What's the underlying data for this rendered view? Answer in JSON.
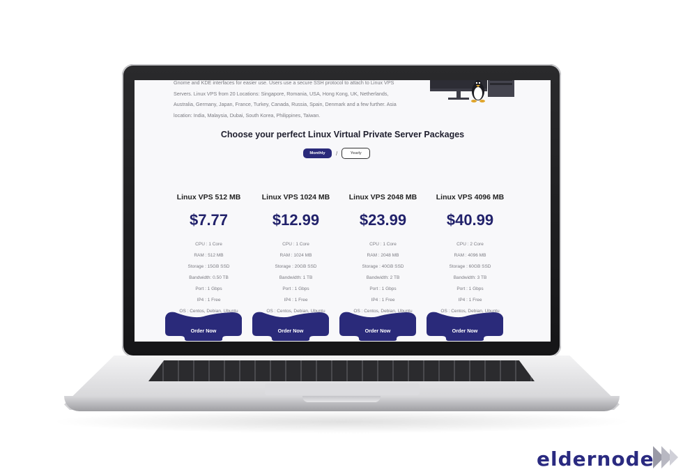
{
  "intro": {
    "lines": [
      "Gnome and KDE interfaces for easier use. Users use a secure SSH protocol to attach to Linux VPS",
      "Servers. Linux VPS from 20 Locations: Singapore, Romania, USA, Hong Kong, UK, Netherlands,",
      "Australia, Germany, Japan, France, Turkey, Canada, Russia, Spain, Denmark and a few further. Asia",
      "location: India, Malaysia, Dubai, South Korea, Philippines, Taiwan."
    ]
  },
  "heading": "Choose your perfect Linux Virtual Private Server Packages",
  "billing": {
    "monthly": "Monthly",
    "separator": "/",
    "yearly": "Yearly"
  },
  "plans": [
    {
      "name": "Linux VPS 512 MB",
      "price": "$7.77",
      "specs": [
        "CPU : 1 Core",
        "RAM : 512 MB",
        "Storage : 15GB SSD",
        "Bandwidth: 0.50 TB",
        "Port : 1 Gbps",
        "IP4 : 1 Free",
        "OS : Centos, Debian, Ubuntu"
      ],
      "order": "Order Now"
    },
    {
      "name": "Linux VPS 1024 MB",
      "price": "$12.99",
      "specs": [
        "CPU : 1 Core",
        "RAM : 1024 MB",
        "Storage : 20GB SSD",
        "Bandwidth: 1 TB",
        "Port : 1 Gbps",
        "IP4 : 1 Free",
        "OS : Centos, Debian, Ubuntu"
      ],
      "order": "Order Now"
    },
    {
      "name": "Linux VPS 2048 MB",
      "price": "$23.99",
      "specs": [
        "CPU : 1 Core",
        "RAM : 2048 MB",
        "Storage : 40GB SSD",
        "Bandwidth: 2 TB",
        "Port : 1 Gbps",
        "IP4 : 1 Free",
        "OS : Centos, Debian, Ubuntu"
      ],
      "order": "Order Now"
    },
    {
      "name": "Linux VPS 4096 MB",
      "price": "$40.99",
      "specs": [
        "CPU : 2 Core",
        "RAM : 4096 MB",
        "Storage : 60GB SSD",
        "Bandwidth: 3 TB",
        "Port : 1 Gbps",
        "IP4 : 1 Free",
        "OS : Centos, Debian, Ubuntu"
      ],
      "order": "Order Now"
    }
  ],
  "logo": {
    "text": "eldernode",
    "icon": "forward-arrows-icon"
  },
  "colors": {
    "accent": "#2a2a7a",
    "price": "#22226b",
    "logo": "#2a2a80"
  }
}
